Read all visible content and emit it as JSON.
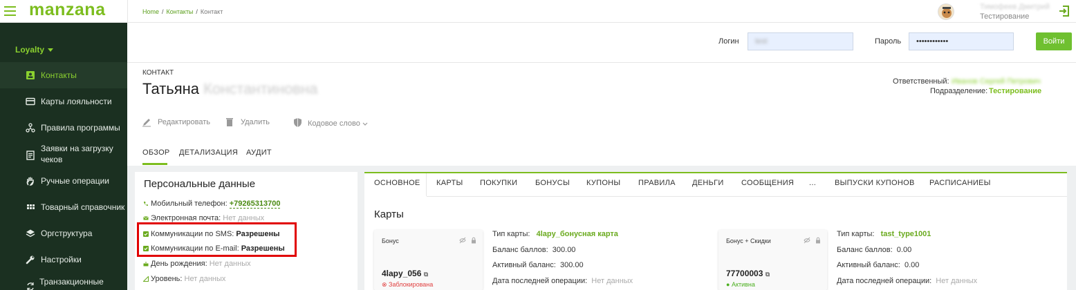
{
  "app": {
    "logo": "manzana"
  },
  "breadcrumb": {
    "home": "Home",
    "contacts": "Контакты",
    "current": "Контакт"
  },
  "user": {
    "name": "Тимофеев Дмитрий",
    "dept": "Тестирование"
  },
  "sidebar": {
    "section": "Loyalty",
    "items": [
      {
        "label": "Контакты",
        "icon": "contact-card-icon",
        "active": true
      },
      {
        "label": "Карты лояльности",
        "icon": "card-icon"
      },
      {
        "label": "Правила программы",
        "icon": "rules-icon"
      },
      {
        "label": "Заявки на загрузку",
        "label2": "чеков",
        "icon": "receipt-icon"
      },
      {
        "label": "Ручные операции",
        "icon": "hand-icon"
      },
      {
        "label": "Товарный справочник",
        "icon": "grid-icon"
      },
      {
        "label": "Оргструктура",
        "icon": "layers-icon"
      },
      {
        "label": "Настройки",
        "icon": "wrench-icon"
      },
      {
        "label": "Транзакционные",
        "icon": "sync-icon"
      }
    ]
  },
  "auth": {
    "login_label": "Логин",
    "login_value": "test",
    "password_label": "Пароль",
    "password_value": "••••••••••••",
    "submit": "Войти"
  },
  "contact": {
    "kicker": "КОНТАКТ",
    "first_name": "Татьяна",
    "rest_name": "Константиновна",
    "responsible_label": "Ответственный:",
    "responsible_value": "Иванов Сергей Петрович",
    "dept_label": "Подразделение:",
    "dept_value": "Тестирование",
    "actions": {
      "edit": "Редактировать",
      "delete": "Удалить",
      "codeword": "Кодовое слово"
    },
    "tabs": [
      "ОБЗОР",
      "ДЕТАЛИЗАЦИЯ",
      "АУДИТ"
    ]
  },
  "personal": {
    "title": "Персональные данные",
    "phone_label": "Мобильный телефон:",
    "phone_value": "+79265313700",
    "email_label": "Электронная почта:",
    "email_value": "Нет данных",
    "sms_label": "Коммуникации по SMS:",
    "sms_value": "Разрешены",
    "mail_label": "Коммуникации по E-mail:",
    "mail_value": "Разрешены",
    "birthday_label": "День рождения:",
    "birthday_value": "Нет данных",
    "level_label": "Уровень:",
    "level_value": "Нет данных"
  },
  "main_tabs": [
    "ОСНОВНОЕ",
    "КАРТЫ",
    "ПОКУПКИ",
    "БОНУСЫ",
    "КУПОНЫ",
    "ПРАВИЛА",
    "ДЕНЬГИ",
    "СООБЩЕНИЯ",
    "...",
    "ВЫПУСКИ КУПОНОВ",
    "РАСПИСАНИЕЫ"
  ],
  "cards_section": {
    "title": "Карты",
    "cards": [
      {
        "type": "Бонус",
        "number": "4lapy_056",
        "status": "Заблокирована",
        "status_color": "#e04040",
        "type_label": "Тип карты:",
        "type_value": "4lapy_бонусная карта",
        "balance_label": "Баланс баллов:",
        "balance_value": "300.00",
        "active_label": "Активный баланс:",
        "active_value": "300.00",
        "last_label": "Дата последней операции:",
        "last_value": "Нет данных"
      },
      {
        "type": "Бонус + Скидки",
        "number": "77700003",
        "status": "Активна",
        "status_color": "#4caf20",
        "type_label": "Тип карты:",
        "type_value": "tast_type1001",
        "balance_label": "Баланс баллов:",
        "balance_value": "0.00",
        "active_label": "Активный баланс:",
        "active_value": "0.00",
        "last_label": "Дата последней операции:",
        "last_value": "Нет данных"
      }
    ]
  },
  "colors": {
    "accent": "#7cbd1e",
    "sidebar": "#1b3021",
    "highlight": "#e10000"
  }
}
